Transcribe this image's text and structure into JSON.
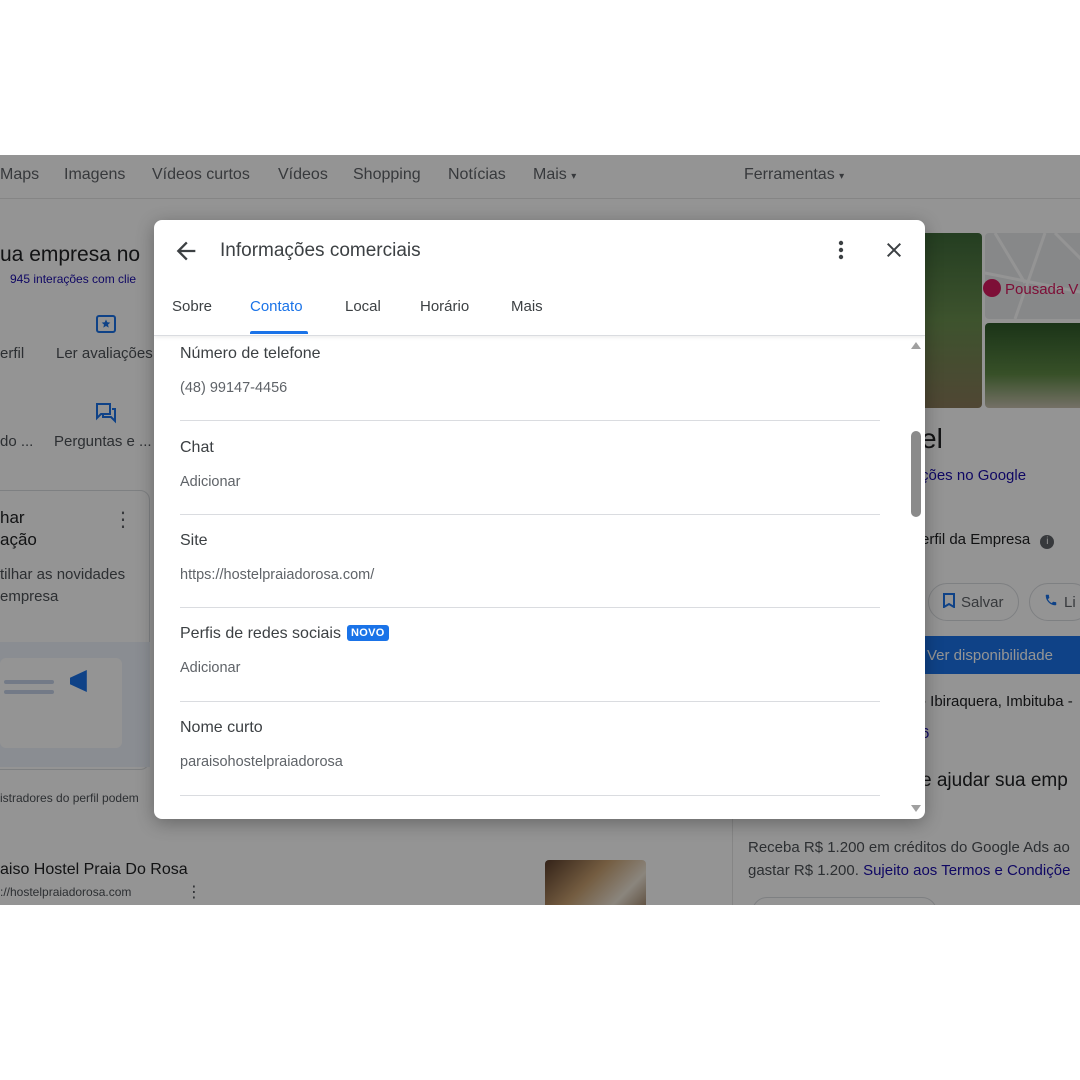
{
  "nav": {
    "items": [
      "Maps",
      "Imagens",
      "Vídeos curtos",
      "Vídeos",
      "Shopping",
      "Notícias",
      "Mais",
      "Ferramentas"
    ]
  },
  "left_panel": {
    "heading": "ua empresa no",
    "interactions": "945 interações com clie",
    "action_profile": "erfil",
    "action_reviews": "Ler avaliações",
    "action_update": "do ...",
    "action_questions": "Perguntas e ...",
    "card_title_1": "har",
    "card_title_2": "ação",
    "card_text_1": "tilhar as novidades",
    "card_text_2": "empresa",
    "admins_note": "istradores do perfil podem",
    "result_title": "aiso Hostel Praia Do Rosa",
    "result_url": "://hostelpraiadorosa.com"
  },
  "right_panel": {
    "map_pin_label": "Pousada V",
    "business_name_fragment": "el",
    "google_reviews_link": "ções no Google",
    "profile_label": "erfil da Empresa",
    "save_label": "Salvar",
    "call_label": "Li",
    "availability_label": "Ver disponibilidade",
    "address": "- Ibiraquera, Imbituba -",
    "phone_fragment": "6",
    "help_heading": "e ajudar sua emp",
    "ads_text_1": "Receba R$ 1.200 em créditos do Google Ads ao",
    "ads_text_2": "gastar R$ 1.200.",
    "ads_terms": "Sujeito aos Termos e Condiçõe"
  },
  "modal": {
    "title": "Informações comerciais",
    "tabs": [
      "Sobre",
      "Contato",
      "Local",
      "Horário",
      "Mais"
    ],
    "active_tab": "Contato",
    "fields": {
      "phone": {
        "label": "Número de telefone",
        "value": "(48) 99147-4456"
      },
      "chat": {
        "label": "Chat",
        "value": "Adicionar"
      },
      "site": {
        "label": "Site",
        "value": "https://hostelpraiadorosa.com/"
      },
      "social": {
        "label": "Perfis de redes sociais",
        "badge": "NOVO",
        "value": "Adicionar"
      },
      "short_name": {
        "label": "Nome curto",
        "value": "paraisohostelpraiadorosa"
      }
    }
  },
  "colors": {
    "accent": "#1a73e8",
    "link": "#1a0dab",
    "scrim": "rgba(0,0,0,0.42)"
  }
}
